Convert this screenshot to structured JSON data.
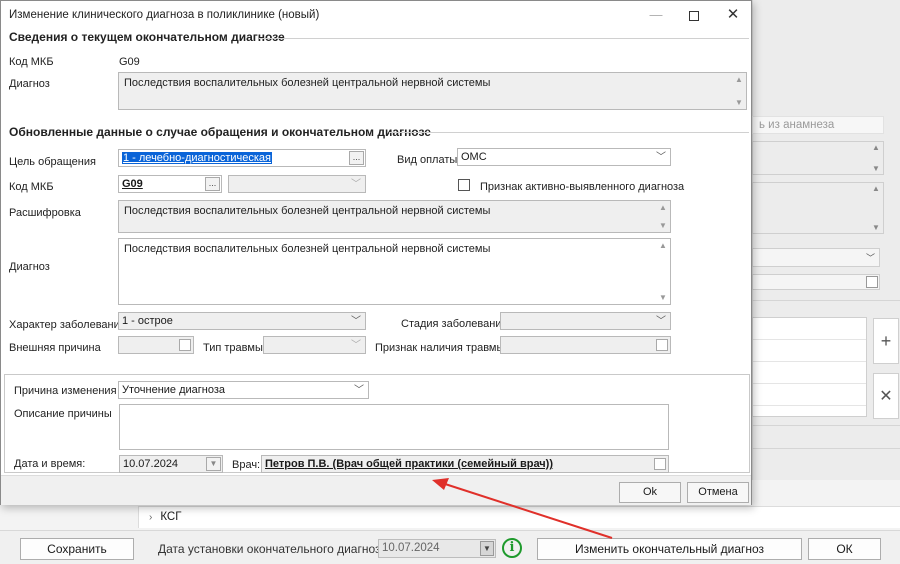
{
  "dialog": {
    "title": "Изменение клинического диагноза в поликлинике (новый)",
    "section_current": "Сведения о текущем окончательном диагнозе",
    "current": {
      "mkb_label": "Код МКБ",
      "mkb_value": "G09",
      "diag_label": "Диагноз",
      "diag_value": "Последствия воспалительных болезней центральной нервной системы"
    },
    "section_updated": "Обновленные данные о случае обращения и окончательном диагнозе",
    "updated": {
      "purpose_label": "Цель обращения",
      "purpose_value": "1 - лечебно-диагностическая",
      "payment_label": "Вид оплаты",
      "payment_value": "ОМС",
      "mkb_label": "Код МКБ",
      "mkb_value": "G09",
      "active_label": "Признак активно-выявленного диагноза",
      "decode_label": "Расшифровка",
      "decode_value": "Последствия воспалительных болезней центральной нервной системы",
      "diag_label": "Диагноз",
      "diag_value": "Последствия воспалительных болезней центральной нервной системы",
      "character_label": "Характер заболевания",
      "character_value": "1 - острое",
      "stage_label": "Стадия заболевания",
      "external_label": "Внешняя причина",
      "trauma_label": "Тип травмы",
      "trauma_sign_label": "Признак наличия травмы"
    },
    "change": {
      "reason_label": "Причина изменения",
      "reason_value": "Уточнение диагноза",
      "desc_label": "Описание причины",
      "datetime_label": "Дата и время:",
      "datetime_value": "10.07.2024",
      "doctor_label": "Врач:",
      "doctor_value": "Петров П.В. (Врач общей практики (семейный врач))"
    },
    "ok_label": "Ok",
    "cancel_label": "Отмена"
  },
  "background": {
    "anamnesis_label": "ь из анамнеза",
    "tree_item": "КСГ",
    "save_label": "Сохранить",
    "final_date_label": "Дата установки окончательного диагноза:",
    "final_date_value": "10.07.2024",
    "change_final_label": "Изменить окончательный диагноз",
    "ok_label": "ОК"
  },
  "colors": {
    "selection": "#0a64d8",
    "arrow": "#e0302a",
    "info": "#1e9a2c"
  }
}
